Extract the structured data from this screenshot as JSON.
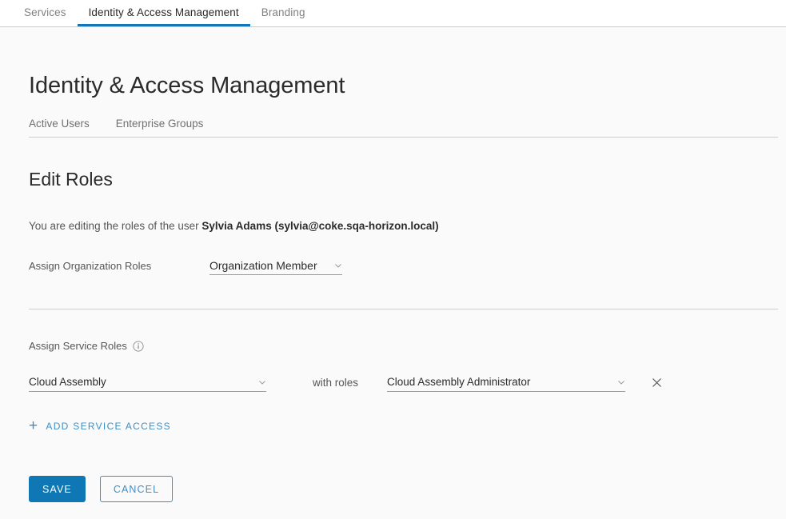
{
  "topnav": {
    "tabs": [
      {
        "label": "Services",
        "active": false
      },
      {
        "label": "Identity & Access Management",
        "active": true
      },
      {
        "label": "Branding",
        "active": false
      }
    ]
  },
  "page": {
    "title": "Identity & Access Management",
    "subtabs": [
      {
        "label": "Active Users"
      },
      {
        "label": "Enterprise Groups"
      }
    ],
    "section_title": "Edit Roles",
    "description_prefix": "You are editing the roles of the user ",
    "description_user": "Sylvia Adams (sylvia@coke.sqa-horizon.local)"
  },
  "org_roles": {
    "label": "Assign Organization Roles",
    "selected": "Organization Member"
  },
  "service_roles": {
    "label": "Assign Service Roles",
    "info_icon": "info-circle-icon",
    "with_roles_text": "with roles",
    "rows": [
      {
        "service": "Cloud Assembly",
        "role": "Cloud Assembly Administrator",
        "remove_icon": "close-icon"
      }
    ],
    "add_label": "ADD SERVICE ACCESS",
    "add_icon": "plus-icon"
  },
  "actions": {
    "save_label": "SAVE",
    "cancel_label": "CANCEL"
  },
  "colors": {
    "accent": "#0f78b4",
    "link": "#3f8fc4",
    "background": "#fafafa",
    "text": "#565656"
  }
}
